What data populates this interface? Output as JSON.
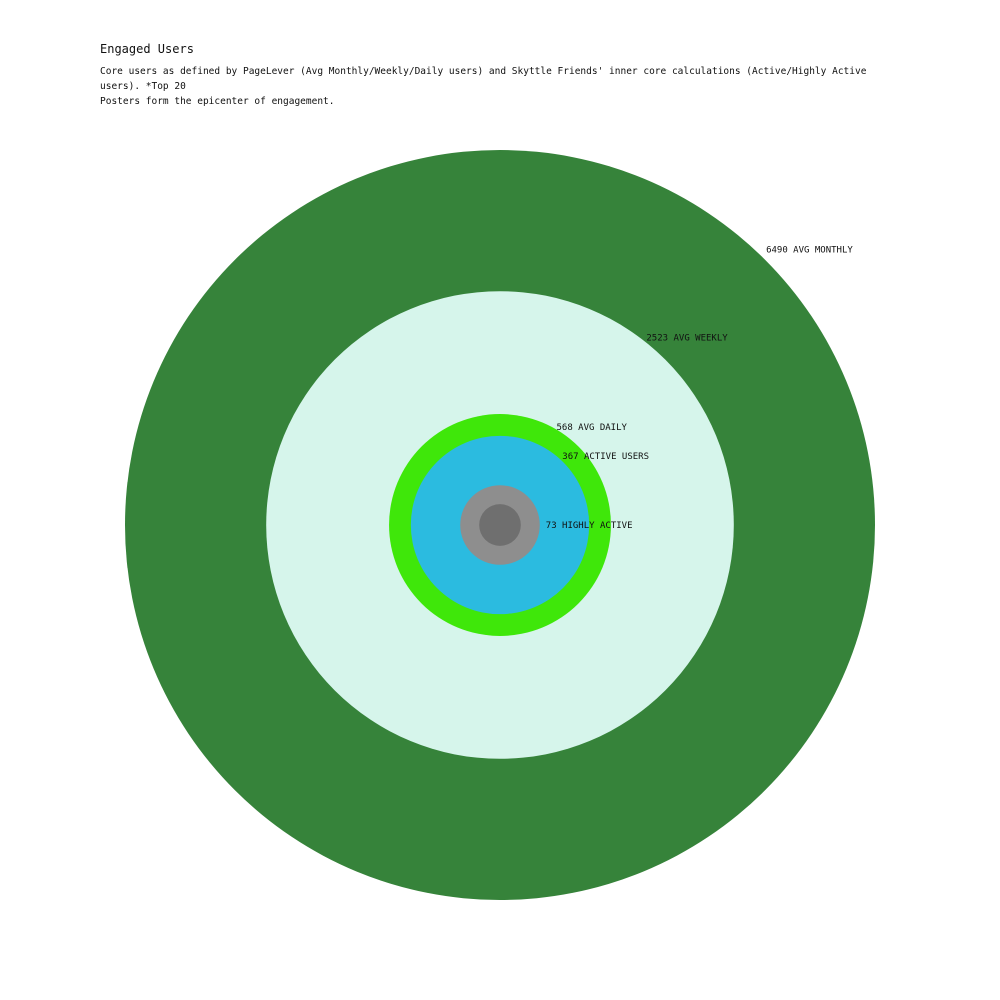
{
  "title": "Engaged Users",
  "subtitle_lines": [
    "Core users as defined by PageLever (Avg Monthly/Weekly/Daily users) and Skyttle Friends' inner core calculations (Active/Highly Active users).  *Top 20",
    "Posters form the epicenter of engagement."
  ],
  "chart_data": {
    "type": "nested-circles",
    "title": "Engaged Users",
    "series": [
      {
        "name": "AVG MONTHLY",
        "value": 6490,
        "label": "6490 AVG MONTHLY",
        "color": "#36833a"
      },
      {
        "name": "AVG WEEKLY",
        "value": 2523,
        "label": "2523 AVG WEEKLY",
        "color": "#d6f5eb"
      },
      {
        "name": "AVG DAILY",
        "value": 568,
        "label": "568 AVG DAILY",
        "color": "#3fe70a"
      },
      {
        "name": "ACTIVE USERS",
        "value": 367,
        "label": "367 ACTIVE USERS",
        "color": "#2bbbe0"
      },
      {
        "name": "HIGHLY ACTIVE",
        "value": 73,
        "label": "73 HIGHLY ACTIVE",
        "color": "#8e8e8e"
      },
      {
        "name": "Top 20",
        "value": 20,
        "label": "",
        "color": "#6f6f6f"
      }
    ]
  }
}
